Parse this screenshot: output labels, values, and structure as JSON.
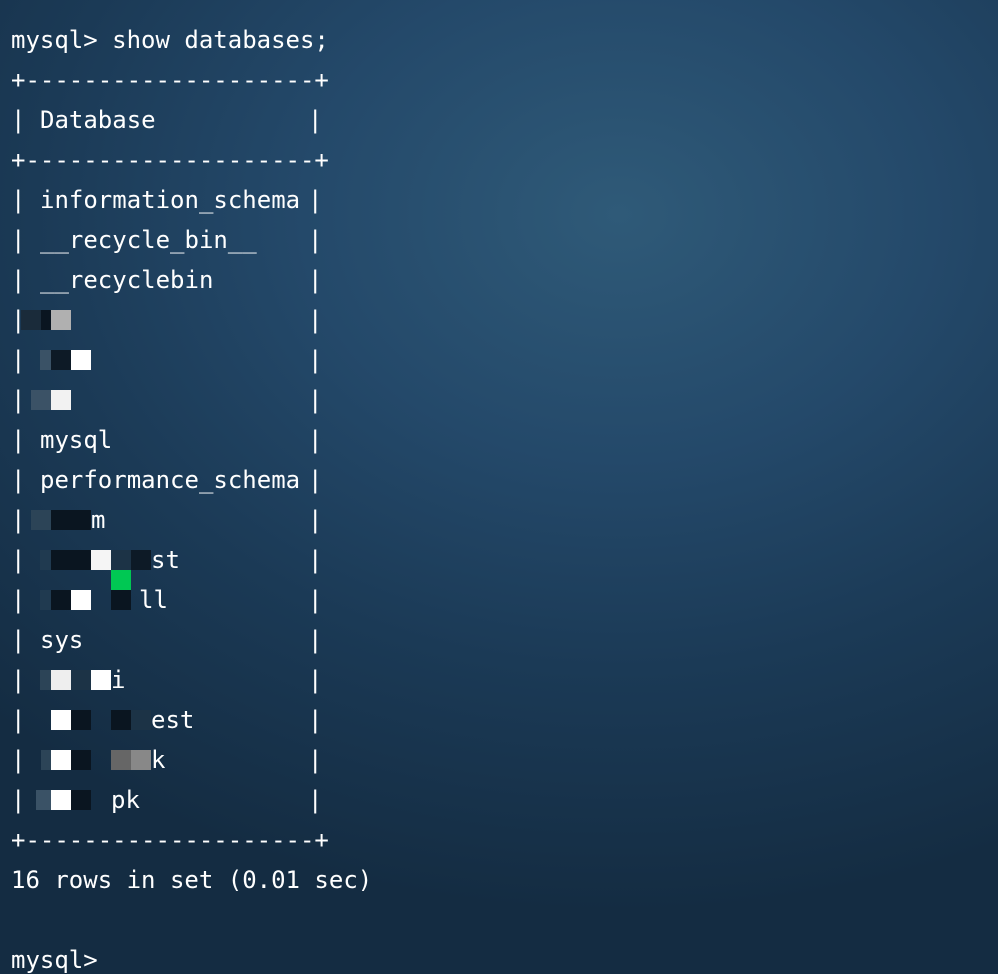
{
  "terminal": {
    "command_line": "mysql> show databases;",
    "table_border": "+--------------------+",
    "header": {
      "left": "|",
      "label": "Database",
      "right": "|"
    },
    "rows": [
      {
        "label": "information_schema",
        "masked": false
      },
      {
        "label": "__recycle_bin__",
        "masked": false
      },
      {
        "label": "__recyclebin",
        "masked": false
      },
      {
        "label": "",
        "masked": true,
        "visible_suffix": ""
      },
      {
        "label": "",
        "masked": true,
        "visible_suffix": ""
      },
      {
        "label": "",
        "masked": true,
        "visible_suffix": ""
      },
      {
        "label": "mysql",
        "masked": false
      },
      {
        "label": "performance_schema",
        "masked": false
      },
      {
        "label": "",
        "masked": true,
        "visible_suffix": "m"
      },
      {
        "label": "",
        "masked": true,
        "visible_suffix": "st"
      },
      {
        "label": "",
        "masked": true,
        "visible_suffix": "ll"
      },
      {
        "label": "sys",
        "masked": false
      },
      {
        "label": "",
        "masked": true,
        "visible_suffix": "i"
      },
      {
        "label": "",
        "masked": true,
        "visible_suffix": "est"
      },
      {
        "label": "",
        "masked": true,
        "visible_suffix": "k"
      },
      {
        "label": "",
        "masked": true,
        "visible_suffix": "pk"
      }
    ],
    "pipe": "|",
    "result": "16 rows in set (0.01 sec)",
    "final_prompt": "mysql>"
  },
  "colors": {
    "text": "#ffffff",
    "background": "#24496a",
    "mask_green": "#00c853"
  }
}
